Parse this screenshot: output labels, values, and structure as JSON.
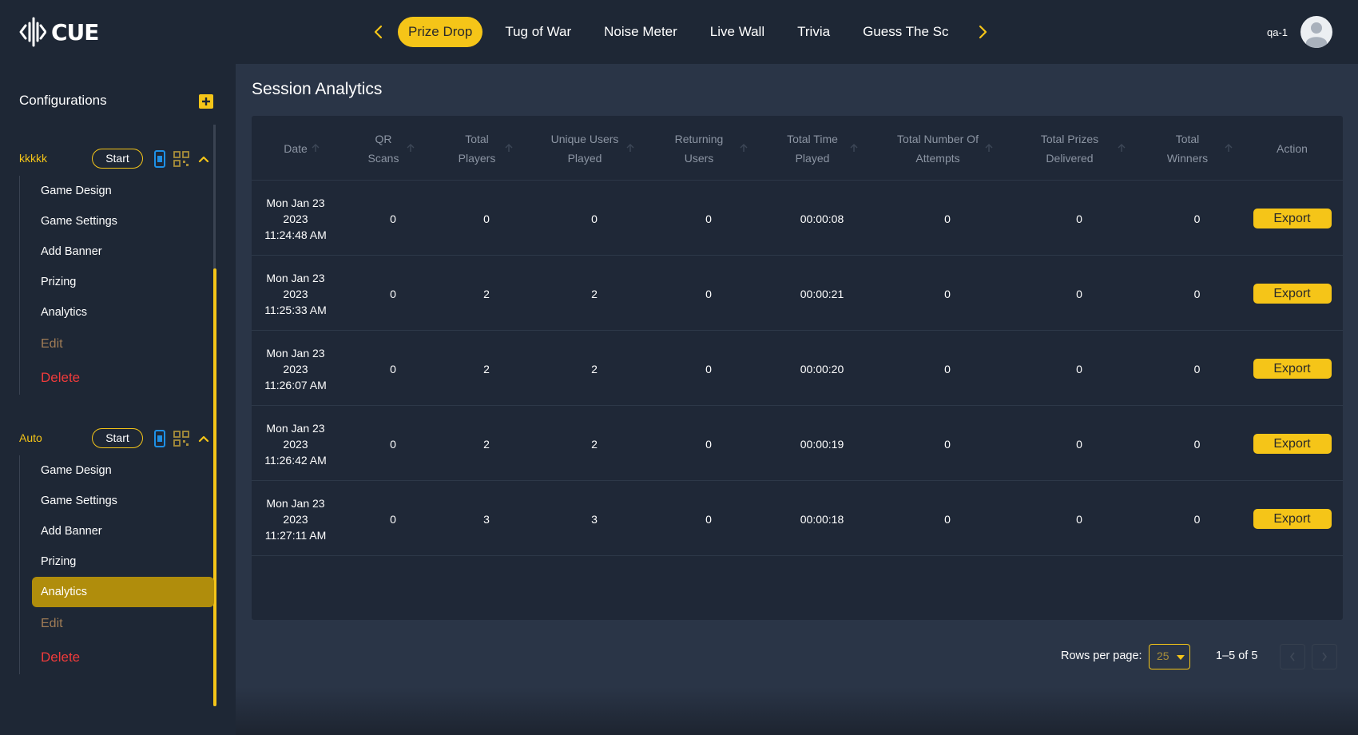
{
  "header": {
    "logo_text": "CUE",
    "tabs": [
      {
        "label": "Prize Drop",
        "active": true
      },
      {
        "label": "Tug of War",
        "active": false
      },
      {
        "label": "Noise Meter",
        "active": false
      },
      {
        "label": "Live Wall",
        "active": false
      },
      {
        "label": "Trivia",
        "active": false
      },
      {
        "label": "Guess The Sc",
        "active": false
      }
    ],
    "user_name": "qa-1"
  },
  "sidebar": {
    "title": "Configurations",
    "configs": [
      {
        "name": "kkkkk",
        "start_label": "Start",
        "items": [
          "Game Design",
          "Game Settings",
          "Add Banner",
          "Prizing",
          "Analytics"
        ],
        "edit_label": "Edit",
        "delete_label": "Delete"
      },
      {
        "name": "Auto",
        "start_label": "Start",
        "items": [
          "Game Design",
          "Game Settings",
          "Add Banner",
          "Prizing",
          "Analytics"
        ],
        "active_item": "Analytics",
        "edit_label": "Edit",
        "delete_label": "Delete"
      }
    ]
  },
  "main": {
    "title": "Session Analytics",
    "table": {
      "columns": [
        {
          "label": "Date",
          "sortable": true
        },
        {
          "label": "QR\nScans",
          "sortable": true
        },
        {
          "label": "Total\nPlayers",
          "sortable": true
        },
        {
          "label": "Unique Users\nPlayed",
          "sortable": true
        },
        {
          "label": "Returning\nUsers",
          "sortable": true
        },
        {
          "label": "Total Time\nPlayed",
          "sortable": true
        },
        {
          "label": "Total Number Of\nAttempts",
          "sortable": true
        },
        {
          "label": "Total Prizes\nDelivered",
          "sortable": true
        },
        {
          "label": "Total\nWinners",
          "sortable": true
        },
        {
          "label": "Action",
          "sortable": false
        }
      ],
      "rows": [
        {
          "date": "Mon Jan 23\n2023\n11:24:48 AM",
          "qr_scans": "0",
          "total_players": "0",
          "unique_users": "0",
          "returning_users": "0",
          "total_time": "00:00:08",
          "attempts": "0",
          "prizes": "0",
          "winners": "0",
          "action": "Export"
        },
        {
          "date": "Mon Jan 23\n2023\n11:25:33 AM",
          "qr_scans": "0",
          "total_players": "2",
          "unique_users": "2",
          "returning_users": "0",
          "total_time": "00:00:21",
          "attempts": "0",
          "prizes": "0",
          "winners": "0",
          "action": "Export"
        },
        {
          "date": "Mon Jan 23\n2023\n11:26:07 AM",
          "qr_scans": "0",
          "total_players": "2",
          "unique_users": "2",
          "returning_users": "0",
          "total_time": "00:00:20",
          "attempts": "0",
          "prizes": "0",
          "winners": "0",
          "action": "Export"
        },
        {
          "date": "Mon Jan 23\n2023\n11:26:42 AM",
          "qr_scans": "0",
          "total_players": "2",
          "unique_users": "2",
          "returning_users": "0",
          "total_time": "00:00:19",
          "attempts": "0",
          "prizes": "0",
          "winners": "0",
          "action": "Export"
        },
        {
          "date": "Mon Jan 23\n2023\n11:27:11 AM",
          "qr_scans": "0",
          "total_players": "3",
          "unique_users": "3",
          "returning_users": "0",
          "total_time": "00:00:18",
          "attempts": "0",
          "prizes": "0",
          "winners": "0",
          "action": "Export"
        }
      ]
    },
    "pagination": {
      "rows_per_page_label": "Rows per page:",
      "rows_per_page_value": "25",
      "range_label": "1–5 of 5"
    }
  },
  "colors": {
    "accent": "#f5c518",
    "background": "#1e2735",
    "panel": "#2a3547",
    "table": "#1f2837",
    "delete": "#ef3b3b",
    "edit": "#a07c56",
    "active_item": "#b08d0c",
    "icon_blue": "#1e90e6"
  },
  "icons": [
    "logo-icon",
    "chevron-left-icon",
    "chevron-right-icon",
    "user-avatar-icon",
    "plus-icon",
    "phone-icon",
    "qr-code-icon",
    "chevron-up-icon",
    "sort-arrow-icon",
    "caret-down-icon"
  ]
}
